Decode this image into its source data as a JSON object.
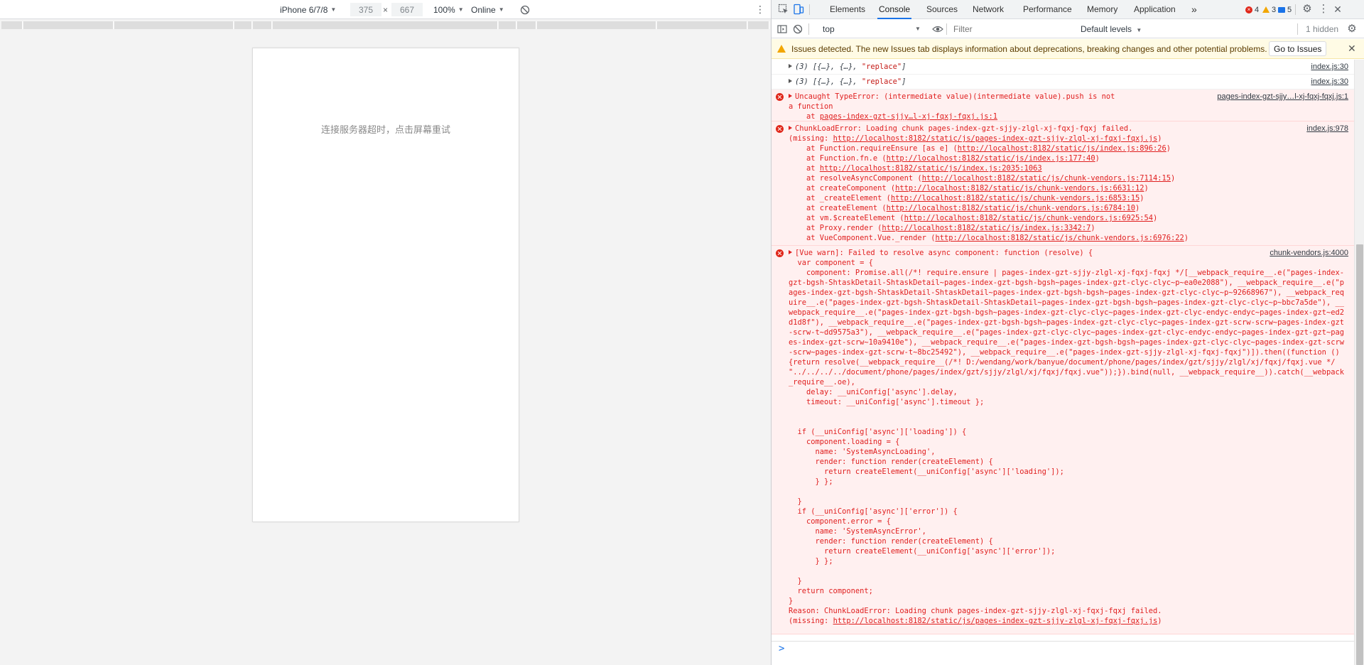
{
  "device_toolbar": {
    "device": "iPhone 6/7/8",
    "width": "375",
    "height": "667",
    "times": "×",
    "zoom": "100%",
    "network": "Online"
  },
  "phone": {
    "message": "连接服务器超时，点击屏幕重试"
  },
  "devtools": {
    "tabs": [
      "Elements",
      "Console",
      "Sources",
      "Network",
      "Performance",
      "Memory",
      "Application"
    ],
    "active_tab": "Console",
    "more_tabs": "»",
    "errors_count": "4",
    "warnings_count": "3",
    "messages_count": "5"
  },
  "console_toolbar": {
    "context": "top",
    "filter_placeholder": "Filter",
    "levels": "Default levels",
    "hidden": "1 hidden"
  },
  "issues_bar": {
    "text": "Issues detected. The new Issues tab displays information about deprecations, breaking changes and other potential problems.",
    "button": "Go to Issues"
  },
  "log": {
    "info1": {
      "count": "(3)",
      "objs": " [{…}, {…}, ",
      "str": "\"replace\"",
      "end": "]",
      "source": "index.js:30"
    },
    "info2": {
      "count": "(3)",
      "objs": " [{…}, {…}, ",
      "str": "\"replace\"",
      "end": "]",
      "source": "index.js:30"
    },
    "err1": {
      "line1": "Uncaught TypeError: (intermediate value)(intermediate value).push is not",
      "line2": "a function",
      "at_prefix": "    at ",
      "at_link": "pages-index-gzt-sjjy…l-xj-fqxj-fqxj.js:1",
      "source": "pages-index-gzt-sjjy…l-xj-fqxj-fqxj.js:1"
    },
    "err2": {
      "head": "ChunkLoadError: Loading chunk pages-index-gzt-sjjy-zlgl-xj-fqxj-fqxj failed.",
      "missing_prefix": "(missing: ",
      "missing_link": "http://localhost:8182/static/js/pages-index-gzt-sjjy-zlgl-xj-fqxj-fqxj.js",
      "missing_suffix": ")",
      "source": "index.js:978",
      "stack": [
        {
          "fn": "    at Function.requireEnsure [as e] (",
          "link": "http://localhost:8182/static/js/index.js:896:26",
          "end": ")"
        },
        {
          "fn": "    at Function.fn.e (",
          "link": "http://localhost:8182/static/js/index.js:177:40",
          "end": ")"
        },
        {
          "fn": "    at ",
          "link": "http://localhost:8182/static/js/index.js:2035:1063",
          "end": ""
        },
        {
          "fn": "    at resolveAsyncComponent (",
          "link": "http://localhost:8182/static/js/chunk-vendors.js:7114:15",
          "end": ")"
        },
        {
          "fn": "    at createComponent (",
          "link": "http://localhost:8182/static/js/chunk-vendors.js:6631:12",
          "end": ")"
        },
        {
          "fn": "    at _createElement (",
          "link": "http://localhost:8182/static/js/chunk-vendors.js:6853:15",
          "end": ")"
        },
        {
          "fn": "    at createElement (",
          "link": "http://localhost:8182/static/js/chunk-vendors.js:6784:10",
          "end": ")"
        },
        {
          "fn": "    at vm.$createElement (",
          "link": "http://localhost:8182/static/js/chunk-vendors.js:6925:54",
          "end": ")"
        },
        {
          "fn": "    at Proxy.render (",
          "link": "http://localhost:8182/static/js/index.js:3342:7",
          "end": ")"
        },
        {
          "fn": "    at VueComponent.Vue._render (",
          "link": "http://localhost:8182/static/js/chunk-vendors.js:6976:22",
          "end": ")"
        }
      ]
    },
    "err3": {
      "source": "chunk-vendors.js:4000",
      "head": "[Vue warn]: Failed to resolve async component: function (resolve) {",
      "body": "  var component = {\n    component: Promise.all(/*! require.ensure | pages-index-gzt-sjjy-zlgl-xj-fqxj-fqxj */[__webpack_require__.e(\"pages-index-gzt-bgsh-ShtaskDetail-ShtaskDetail~pages-index-gzt-bgsh-bgsh~pages-index-gzt-clyc-clyc~p~ea0e2088\"), __webpack_require__.e(\"pages-index-gzt-bgsh-ShtaskDetail-ShtaskDetail~pages-index-gzt-bgsh-bgsh~pages-index-gzt-clyc-clyc~p~92668967\"), __webpack_require__.e(\"pages-index-gzt-bgsh-ShtaskDetail-ShtaskDetail~pages-index-gzt-bgsh-bgsh~pages-index-gzt-clyc-clyc~p~bbc7a5de\"), __webpack_require__.e(\"pages-index-gzt-bgsh-bgsh~pages-index-gzt-clyc-clyc~pages-index-gzt-clyc-endyc-endyc~pages-index-gzt~ed2d1d8f\"), __webpack_require__.e(\"pages-index-gzt-bgsh-bgsh~pages-index-gzt-clyc-clyc~pages-index-gzt-scrw-scrw~pages-index-gzt-scrw-t~dd9575a3\"), __webpack_require__.e(\"pages-index-gzt-clyc-clyc~pages-index-gzt-clyc-endyc-endyc~pages-index-gzt-gzt~pages-index-gzt-scrw~10a9410e\"), __webpack_require__.e(\"pages-index-gzt-bgsh-bgsh~pages-index-gzt-clyc-clyc~pages-index-gzt-scrw-scrw~pages-index-gzt-scrw-t~8bc25492\"), __webpack_require__.e(\"pages-index-gzt-sjjy-zlgl-xj-fqxj-fqxj\")]).then((function () {return resolve(__webpack_require__(/*! D:/wendang/work/banyue/document/phone/pages/index/gzt/sjjy/zlgl/xj/fqxj/fqxj.vue */ \"../../../../document/phone/pages/index/gzt/sjjy/zlgl/xj/fqxj/fqxj.vue\"));}).bind(null, __webpack_require__)).catch(__webpack_require__.oe),\n    delay: __uniConfig['async'].delay,\n    timeout: __uniConfig['async'].timeout };\n\n\n  if (__uniConfig['async']['loading']) {\n    component.loading = {\n      name: 'SystemAsyncLoading',\n      render: function render(createElement) {\n        return createElement(__uniConfig['async']['loading']);\n      } };\n\n  }\n  if (__uniConfig['async']['error']) {\n    component.error = {\n      name: 'SystemAsyncError',\n      render: function render(createElement) {\n        return createElement(__uniConfig['async']['error']);\n      } };\n\n  }\n  return component;\n}",
      "reason": "Reason: ChunkLoadError: Loading chunk pages-index-gzt-sjjy-zlgl-xj-fqxj-fqxj failed.",
      "reason_missing_prefix": "(missing: ",
      "reason_missing_link": "http://localhost:8182/static/js/pages-index-gzt-sjjy-zlgl-xj-fqxj-fqxj.js",
      "reason_missing_suffix": ")"
    }
  },
  "prompt": {
    "caret": ">"
  }
}
